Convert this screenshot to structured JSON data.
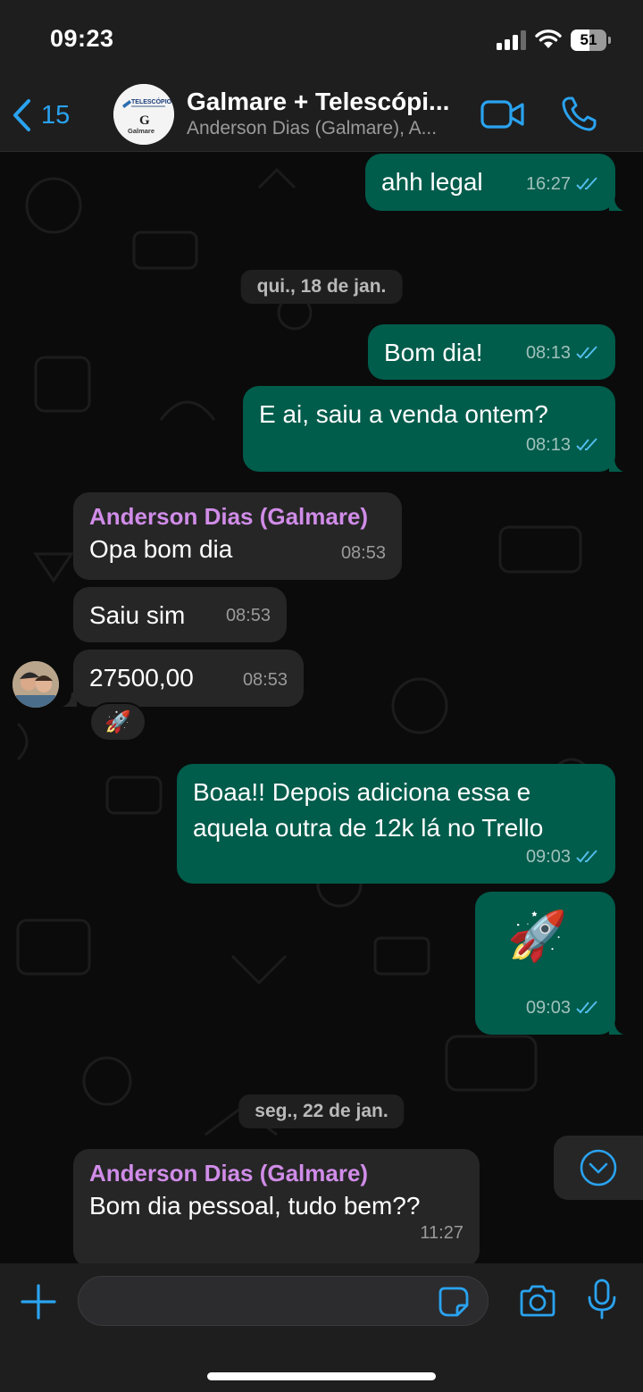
{
  "status_bar": {
    "time": "09:23",
    "battery": "51"
  },
  "header": {
    "back_count": "15",
    "title": "Galmare + Telescópi...",
    "subtitle": "Anderson Dias (Galmare), A...",
    "avatar_text_top": "TELESCÓPIO",
    "avatar_text_bottom": "Galmare",
    "avatar_letter": "G"
  },
  "messages": [
    {
      "text": "ahh legal",
      "time": "16:27"
    },
    {
      "date": "qui., 18 de jan."
    },
    {
      "text": "Bom dia!",
      "time": "08:13"
    },
    {
      "text": "E ai, saiu a venda ontem?",
      "time": "08:13"
    },
    {
      "sender": "Anderson Dias (Galmare)",
      "text": "Opa bom dia",
      "time": "08:53"
    },
    {
      "text": "Saiu sim",
      "time": "08:53"
    },
    {
      "text": "27500,00",
      "time": "08:53",
      "reaction": "🚀"
    },
    {
      "text_line1": "Boaa!! Depois adiciona essa e",
      "text_line2": "aquela outra de 12k lá no Trello",
      "time": "09:03"
    },
    {
      "emoji": "🚀",
      "time": "09:03"
    },
    {
      "date": "seg., 22 de jan."
    },
    {
      "sender": "Anderson Dias (Galmare)",
      "text": "Bom dia pessoal, tudo bem??",
      "time": "11:27"
    }
  ],
  "composer": {
    "value": "",
    "placeholder": ""
  },
  "colors": {
    "accent": "#2aa3f0",
    "outgoing": "#005c4b",
    "incoming": "#262626",
    "sender": "#d08ce8",
    "read_ticks": "#53bdeb"
  },
  "icons": [
    "back-chevron-icon",
    "video-call-icon",
    "voice-call-icon",
    "double-check-icon",
    "chevron-down-icon",
    "plus-icon",
    "sticker-icon",
    "camera-icon",
    "microphone-icon"
  ]
}
